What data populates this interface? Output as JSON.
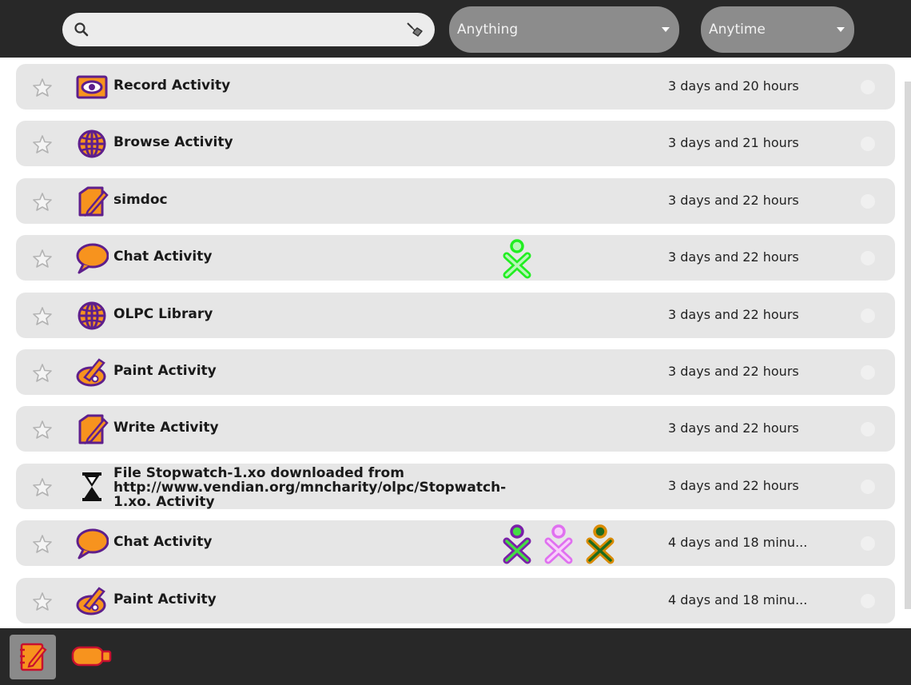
{
  "toolbar": {
    "search": {
      "value": "",
      "placeholder": ""
    },
    "filter_what": "Anything",
    "filter_when": "Anytime"
  },
  "colors": {
    "icon_fill": "#f7931e",
    "icon_stroke": "#5e1f8c",
    "toolbar_bg": "#282828",
    "row_bg": "#e6e6e6",
    "combo_bg": "#8c8c8c"
  },
  "entries": [
    {
      "title": "Record Activity",
      "icon": "record-activity-icon",
      "date": "3 days and 20 hours",
      "buddies": []
    },
    {
      "title": "Browse Activity",
      "icon": "browse-activity-icon",
      "date": "3 days and 21 hours",
      "buddies": []
    },
    {
      "title": "simdoc",
      "icon": "write-document-icon",
      "date": "3 days and 22 hours",
      "buddies": []
    },
    {
      "title": "Chat Activity",
      "icon": "chat-activity-icon",
      "date": "3 days and 22 hours",
      "buddies": [
        {
          "stroke": "#22ee22",
          "fill": "#b8f7b8"
        }
      ]
    },
    {
      "title": "OLPC Library",
      "icon": "browse-activity-icon",
      "date": "3 days and 22 hours",
      "buddies": []
    },
    {
      "title": "Paint Activity",
      "icon": "paint-activity-icon",
      "date": "3 days and 22 hours",
      "buddies": []
    },
    {
      "title": "Write Activity",
      "icon": "write-document-icon",
      "date": "3 days and 22 hours",
      "buddies": []
    },
    {
      "title": "File Stopwatch-1.xo downloaded from http://www.vendian.org/mncharity/olpc/Stopwatch-1.xo. Activity",
      "icon": "hourglass-download-icon",
      "date": "3 days and 22 hours",
      "buddies": []
    },
    {
      "title": "Chat Activity",
      "icon": "chat-activity-icon",
      "date": "4 days and 18 minu...",
      "buddies": [
        {
          "stroke": "#7a1fa8",
          "fill": "#44dd44"
        },
        {
          "stroke": "#e070f0",
          "fill": "#f8d0fb"
        },
        {
          "stroke": "#d98a00",
          "fill": "#1e6b1e"
        }
      ]
    },
    {
      "title": "Paint Activity",
      "icon": "paint-activity-icon",
      "date": "4 days and 18 minu...",
      "buddies": []
    }
  ],
  "bottom": {
    "journal_icon": "journal-icon",
    "usb_icon": "usb-device-icon"
  }
}
